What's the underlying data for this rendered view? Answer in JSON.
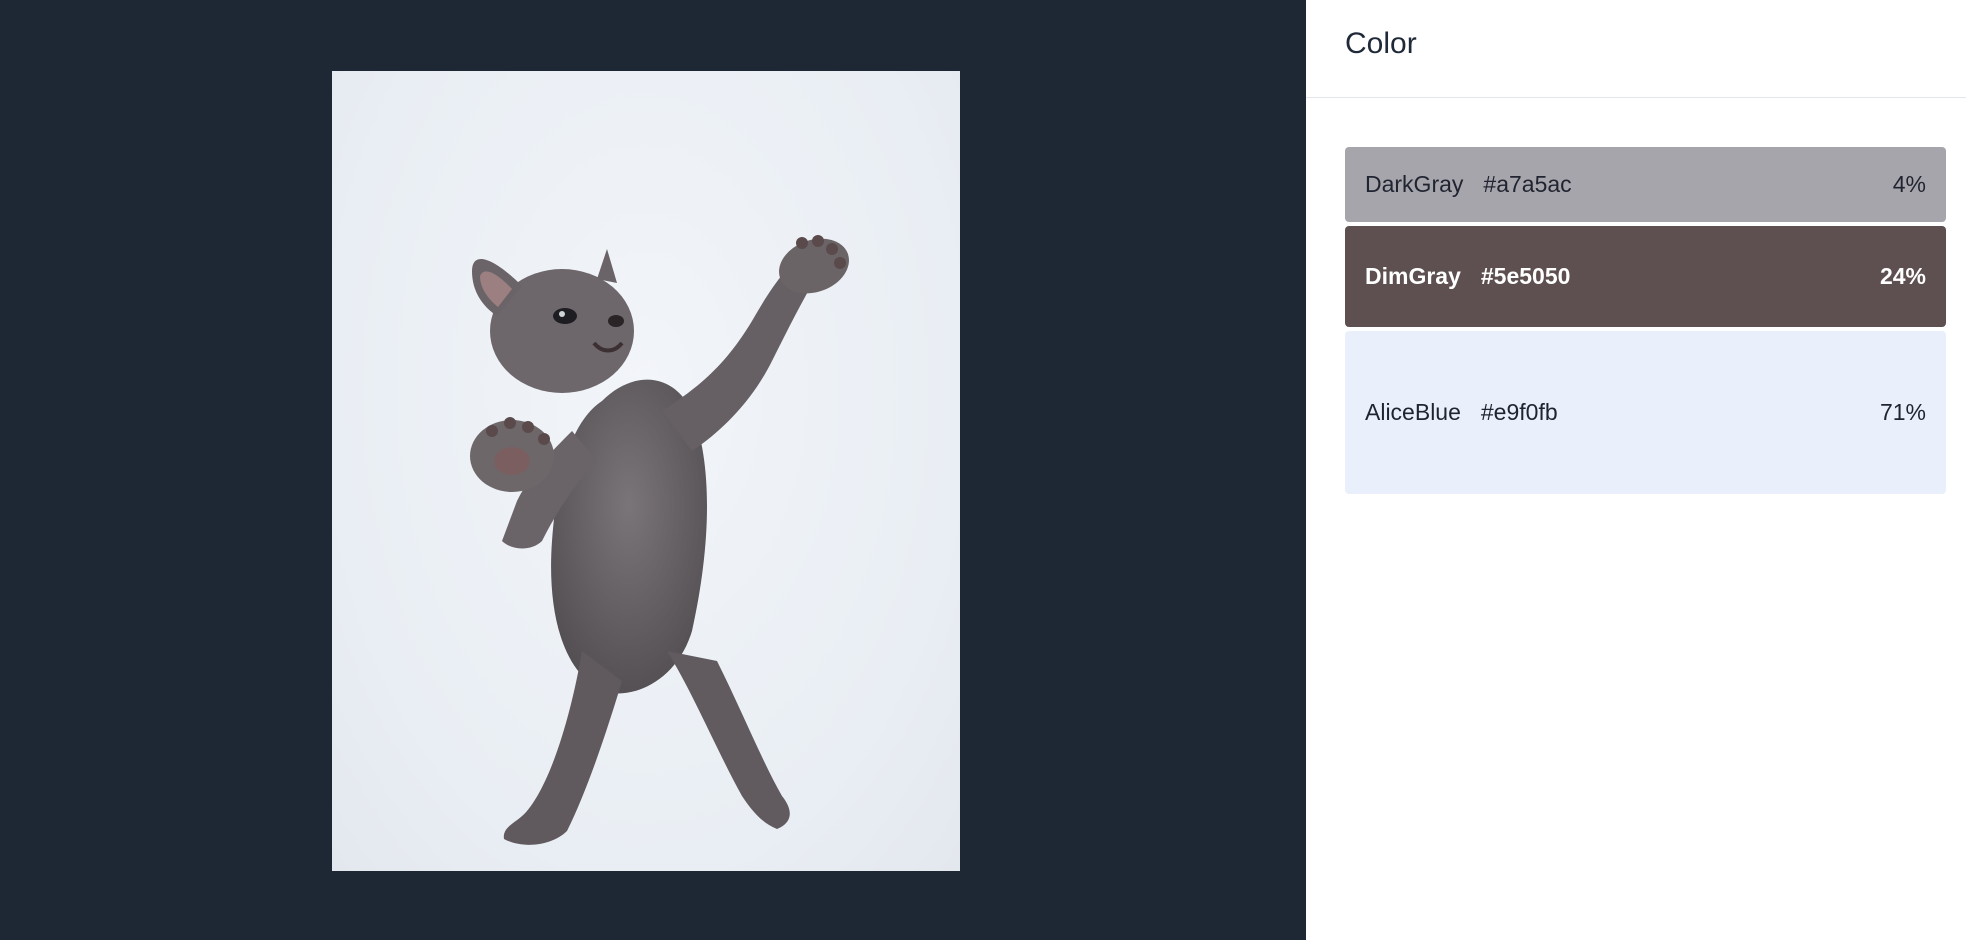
{
  "panel": {
    "title": "Color"
  },
  "swatches": [
    {
      "name": "DarkGray",
      "hex": "#a7a5ac",
      "percent": "4%"
    },
    {
      "name": "DimGray",
      "hex": "#5e5050",
      "percent": "24%"
    },
    {
      "name": "AliceBlue",
      "hex": "#e9f0fb",
      "percent": "71%"
    }
  ],
  "colors": {
    "viewer_background": "#1e2734",
    "panel_background": "#ffffff"
  }
}
